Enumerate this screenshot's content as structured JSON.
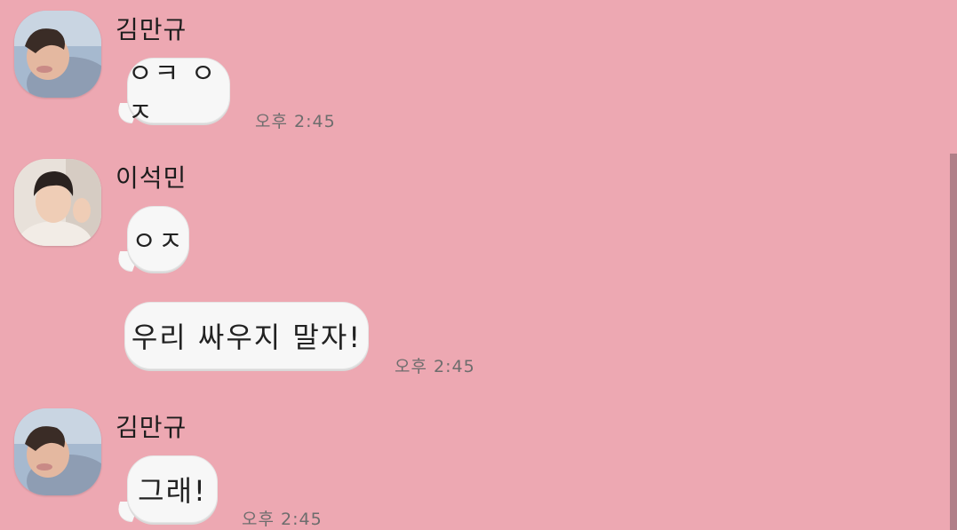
{
  "messages": [
    {
      "sender": "김만규",
      "text": "ㅇㅋ ㅇㅈ",
      "time": "오후 2:45"
    },
    {
      "sender": "이석민",
      "text": "ㅇㅈ"
    },
    {
      "text": "우리 싸우지 말자!",
      "time": "오후 2:45"
    },
    {
      "sender": "김만규",
      "text": "그래!",
      "time": "오후 2:45"
    }
  ],
  "colors": {
    "background": "#eda8b2",
    "bubble": "#f7f7f7",
    "time": "#6d6d6d"
  }
}
